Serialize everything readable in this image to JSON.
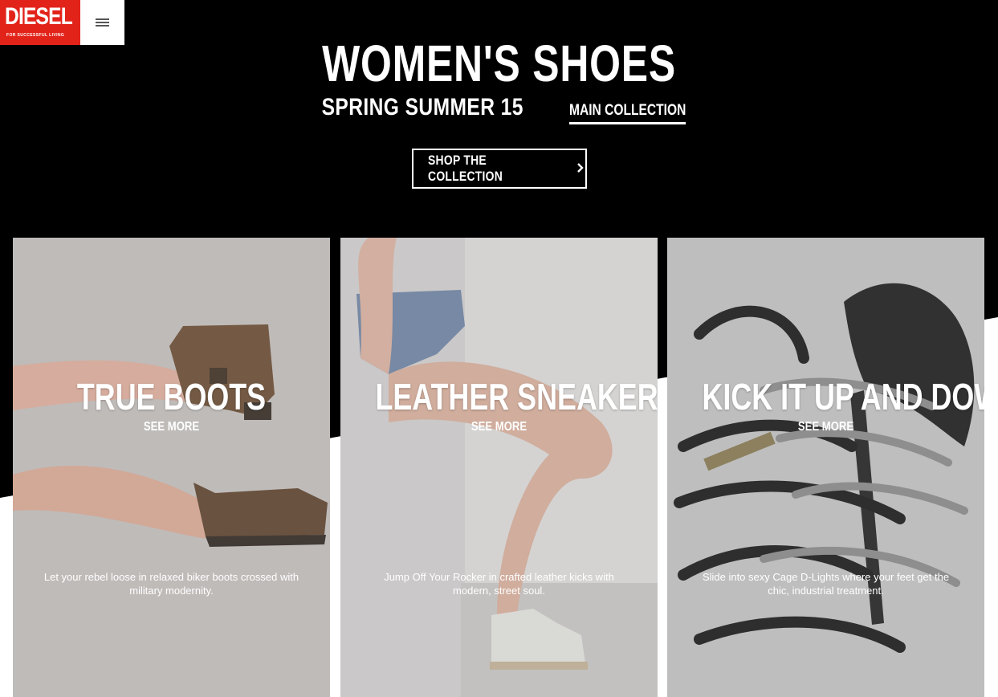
{
  "brand": {
    "name": "DIESEL",
    "tagline": "FOR SUCCESSFUL LIVING",
    "color": "#e2231a"
  },
  "header": {
    "menu_icon": "hamburger-menu-icon",
    "title": "WOMEN'S SHOES",
    "season": "SPRING SUMMER 15",
    "collection_link": "MAIN COLLECTION",
    "cta_label": "SHOP THE COLLECTION",
    "cta_icon": "chevron-right-icon"
  },
  "cards": [
    {
      "title": "TRUE BOOTS",
      "see_more": "SEE MORE",
      "description": "Let your rebel loose in relaxed biker boots crossed with military modernity."
    },
    {
      "title": "LEATHER SNEAKERS",
      "see_more": "SEE MORE",
      "description": "Jump Off Your Rocker in crafted leather kicks with modern, street soul."
    },
    {
      "title": "KICK IT UP AND DOWN",
      "see_more": "SEE MORE",
      "description": "Slide into sexy Cage D-Lights where your feet get the chic, industrial treatment."
    }
  ]
}
